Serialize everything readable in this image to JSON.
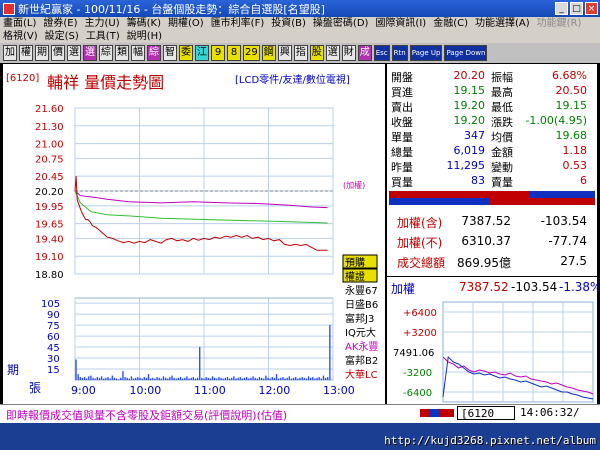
{
  "window": {
    "title": "新世紀贏家 - 100/11/16 - 台盤個股走勢：綜合自選股[名望股]"
  },
  "menu": {
    "row1": [
      {
        "label": "畫面(L)",
        "enabled": true
      },
      {
        "label": "證券(E)",
        "enabled": true
      },
      {
        "label": "主力(U)",
        "enabled": true
      },
      {
        "label": "籌碼(K)",
        "enabled": true
      },
      {
        "label": "期權(O)",
        "enabled": true
      },
      {
        "label": "匯市利率(F)",
        "enabled": true
      },
      {
        "label": "投資(B)",
        "enabled": true
      },
      {
        "label": "操盤密碼(D)",
        "enabled": true
      },
      {
        "label": "國際資訊(I)",
        "enabled": true
      },
      {
        "label": "金融(C)",
        "enabled": true
      },
      {
        "label": "功能選擇(A)",
        "enabled": true
      },
      {
        "label": "功能鍵(R)",
        "enabled": false
      }
    ],
    "row2": [
      {
        "label": "格視(V)",
        "enabled": true
      },
      {
        "label": "設定(S)",
        "enabled": true
      },
      {
        "label": "工具(T)",
        "enabled": true
      },
      {
        "label": "說明(H)",
        "enabled": true
      }
    ]
  },
  "toolbar": [
    {
      "label": "加",
      "style": "g"
    },
    {
      "label": "權",
      "style": "g"
    },
    {
      "label": "期",
      "style": "g"
    },
    {
      "label": "價",
      "style": "g"
    },
    {
      "label": "選",
      "style": "g"
    },
    {
      "label": "選",
      "style": "m"
    },
    {
      "label": "綜",
      "style": "g"
    },
    {
      "label": "類",
      "style": "g"
    },
    {
      "label": "幅",
      "style": "g"
    },
    {
      "label": "綜",
      "style": "m"
    },
    {
      "label": "智",
      "style": "g"
    },
    {
      "label": "委",
      "style": "y"
    },
    {
      "label": "江",
      "style": "c"
    },
    {
      "label": "9",
      "style": "y"
    },
    {
      "label": "8",
      "style": "y"
    },
    {
      "label": "29",
      "style": "y"
    },
    {
      "label": "鋼",
      "style": "y"
    },
    {
      "label": "興",
      "style": "g"
    },
    {
      "label": "指",
      "style": "g"
    },
    {
      "label": "股",
      "style": "y"
    },
    {
      "label": "選",
      "style": "g"
    },
    {
      "label": "財",
      "style": "g"
    },
    {
      "label": "成",
      "style": "m"
    },
    {
      "label": "Esc",
      "style": "b"
    },
    {
      "label": "Rtn",
      "style": "b"
    },
    {
      "label": "Page Up",
      "style": "b"
    },
    {
      "label": "Page Down",
      "style": "b"
    }
  ],
  "stock": {
    "code": "[6120]",
    "title": "輔祥  量價走勢圖",
    "category": "[LCD零件/友達/數位電視]"
  },
  "chart_data": {
    "type": "line",
    "price_axis": {
      "ticks": [
        21.6,
        21.3,
        21.0,
        20.75,
        20.45,
        20.2,
        19.95,
        19.65,
        19.4,
        19.1,
        18.8
      ],
      "reference": 20.2
    },
    "x_ticks": [
      "9:00",
      "10:00",
      "11:00",
      "12:00",
      "13:00"
    ],
    "volume_axis": {
      "ticks": [
        105,
        90,
        75,
        60,
        45,
        30,
        15
      ],
      "top_label": "期",
      "bottom_label": "張"
    },
    "index_label": "(加權)",
    "price_series": [
      [
        0,
        20.2
      ],
      [
        1,
        20.45
      ],
      [
        2,
        20.05
      ],
      [
        4,
        19.95
      ],
      [
        6,
        19.85
      ],
      [
        8,
        19.78
      ],
      [
        10,
        19.72
      ],
      [
        12,
        19.72
      ],
      [
        14,
        19.68
      ],
      [
        16,
        19.62
      ],
      [
        18,
        19.6
      ],
      [
        20,
        19.58
      ],
      [
        22,
        19.55
      ],
      [
        25,
        19.5
      ],
      [
        30,
        19.42
      ],
      [
        35,
        19.4
      ],
      [
        40,
        19.36
      ],
      [
        45,
        19.33
      ],
      [
        50,
        19.35
      ],
      [
        55,
        19.32
      ],
      [
        60,
        19.35
      ],
      [
        65,
        19.33
      ],
      [
        70,
        19.38
      ],
      [
        75,
        19.35
      ],
      [
        80,
        19.32
      ],
      [
        85,
        19.38
      ],
      [
        90,
        19.4
      ],
      [
        95,
        19.36
      ],
      [
        100,
        19.38
      ],
      [
        105,
        19.35
      ],
      [
        110,
        19.4
      ],
      [
        115,
        19.37
      ],
      [
        120,
        19.4
      ],
      [
        125,
        19.38
      ],
      [
        130,
        19.42
      ],
      [
        135,
        19.4
      ],
      [
        140,
        19.44
      ],
      [
        145,
        19.42
      ],
      [
        150,
        19.45
      ],
      [
        155,
        19.42
      ],
      [
        160,
        19.45
      ],
      [
        165,
        19.4
      ],
      [
        170,
        19.42
      ],
      [
        175,
        19.38
      ],
      [
        180,
        19.4
      ],
      [
        185,
        19.36
      ],
      [
        190,
        19.38
      ],
      [
        195,
        19.3
      ],
      [
        200,
        19.28
      ],
      [
        205,
        19.3
      ],
      [
        210,
        19.28
      ],
      [
        215,
        19.3
      ],
      [
        220,
        19.25
      ],
      [
        225,
        19.2
      ],
      [
        230,
        19.2
      ],
      [
        235,
        19.2
      ]
    ],
    "avg_series": [
      [
        0,
        20.2
      ],
      [
        5,
        20.0
      ],
      [
        15,
        19.85
      ],
      [
        30,
        19.8
      ],
      [
        50,
        19.78
      ],
      [
        80,
        19.74
      ],
      [
        120,
        19.72
      ],
      [
        160,
        19.7
      ],
      [
        200,
        19.68
      ],
      [
        235,
        19.66
      ]
    ],
    "index_series": [
      [
        0,
        20.2
      ],
      [
        5,
        20.12
      ],
      [
        15,
        20.1
      ],
      [
        30,
        20.06
      ],
      [
        50,
        20.02
      ],
      [
        80,
        20.0
      ],
      [
        110,
        20.02
      ],
      [
        140,
        20.0
      ],
      [
        170,
        19.99
      ],
      [
        200,
        19.96
      ],
      [
        220,
        19.93
      ],
      [
        235,
        19.92
      ]
    ],
    "volume_series": [
      28,
      8,
      4,
      3,
      4,
      2,
      5,
      6,
      3,
      2,
      4,
      3,
      5,
      2,
      3,
      4,
      2,
      6,
      3,
      2,
      1,
      3,
      12,
      4,
      3,
      2,
      5,
      2,
      3,
      4,
      3,
      2,
      4,
      3,
      8,
      2,
      3,
      2,
      4,
      3,
      2,
      5,
      3,
      2,
      4,
      6,
      3,
      2,
      3,
      4,
      2,
      3,
      5,
      2,
      3,
      4,
      2,
      3,
      45,
      3,
      2,
      4,
      3,
      2,
      5,
      3,
      2,
      4,
      3,
      2,
      3,
      4,
      2,
      3,
      5,
      2,
      3,
      4,
      2,
      3,
      4,
      2,
      3,
      5,
      3,
      2,
      4,
      3,
      2,
      6,
      3,
      2,
      4,
      3,
      8,
      2,
      3,
      4,
      2,
      3,
      5,
      2,
      3,
      4,
      2,
      3,
      4,
      3,
      2,
      5,
      3,
      4,
      2,
      3,
      4,
      2,
      6,
      3,
      4,
      75
    ],
    "colors": {
      "price": "#c00000",
      "avg": "#30c030",
      "index": "#c000c0",
      "volume": "#2040ff",
      "ref": "#808080"
    }
  },
  "side_labels": [
    {
      "text": "預購",
      "style": "box-yellow"
    },
    {
      "text": "權證",
      "style": "box-yellow"
    },
    {
      "text": "永豐67",
      "style": "black"
    },
    {
      "text": "日盛B6",
      "style": "black"
    },
    {
      "text": "富邦J3",
      "style": "black"
    },
    {
      "text": "IQ元大",
      "style": "black"
    },
    {
      "text": "AK永豐",
      "style": "magenta"
    },
    {
      "text": "富邦B2",
      "style": "black"
    },
    {
      "text": "大華LC",
      "style": "red"
    }
  ],
  "quote": {
    "rows": [
      {
        "l1": "開盤",
        "v1": "20.20",
        "c1": "#c00000",
        "l2": "振幅",
        "v2": "6.68%",
        "c2": "#c00000"
      },
      {
        "l1": "買進",
        "v1": "19.15",
        "c1": "#008000",
        "l2": "最高",
        "v2": "20.50",
        "c2": "#c00000"
      },
      {
        "l1": "賣出",
        "v1": "19.20",
        "c1": "#008000",
        "l2": "最低",
        "v2": "19.15",
        "c2": "#008000"
      },
      {
        "l1": "收盤",
        "v1": "19.20",
        "c1": "#008000",
        "l2": "漲跌",
        "v2": "-1.00(4.95)",
        "c2": "#008000"
      },
      {
        "l1": "單量",
        "v1": "347",
        "c1": "#0000c0",
        "l2": "均價",
        "v2": "19.68",
        "c2": "#008000"
      },
      {
        "l1": "總量",
        "v1": "6,019",
        "c1": "#0000c0",
        "l2": "金額",
        "v2": "1.18",
        "c2": "#c00000"
      },
      {
        "l1": "昨量",
        "v1": "11,295",
        "c1": "#0000c0",
        "l2": "變動",
        "v2": "0.53",
        "c2": "#c00000"
      },
      {
        "l1": "買量",
        "v1": "83",
        "c1": "#0000c0",
        "l2": "賣量",
        "v2": "6",
        "c2": "#c00000"
      }
    ],
    "index_rows": [
      {
        "label": "加權(含)",
        "value": "7387.52",
        "change": "-103.54"
      },
      {
        "label": "加權(不)",
        "value": "6310.37",
        "change": "-77.74"
      },
      {
        "label": "成交總額",
        "value": "869.95億",
        "change": "27.5"
      }
    ]
  },
  "mini_index": {
    "label": "加權",
    "value": "7387.52",
    "change": "-103.54",
    "pct": "-1.38%",
    "axis_ticks": [
      "+6400",
      "+3200",
      "7491.06",
      "-3200",
      "-6400"
    ],
    "series_a": [
      0.95,
      0.55,
      0.6,
      0.62,
      0.66,
      0.7,
      0.72,
      0.71,
      0.73,
      0.72,
      0.74,
      0.76,
      0.75,
      0.77,
      0.78,
      0.8,
      0.79,
      0.81,
      0.83,
      0.85,
      0.84,
      0.86,
      0.88,
      0.9,
      0.9,
      0.92,
      0.93,
      0.95,
      0.96,
      0.97
    ],
    "series_b": [
      0.55,
      0.6,
      0.62,
      0.66,
      0.64,
      0.68,
      0.7,
      0.68,
      0.69,
      0.71,
      0.7,
      0.72,
      0.73,
      0.71,
      0.74,
      0.75,
      0.74,
      0.77,
      0.78,
      0.79,
      0.8,
      0.82,
      0.81,
      0.83,
      0.85,
      0.86,
      0.88,
      0.89,
      0.9,
      0.92
    ]
  },
  "status": {
    "message": "即時報價成交值與量不含零股及鉅額交易(評價說明)(估值)",
    "code": "[6120",
    "time": "14:06:32/"
  },
  "watermark": "http://kujd3268.pixnet.net/album"
}
